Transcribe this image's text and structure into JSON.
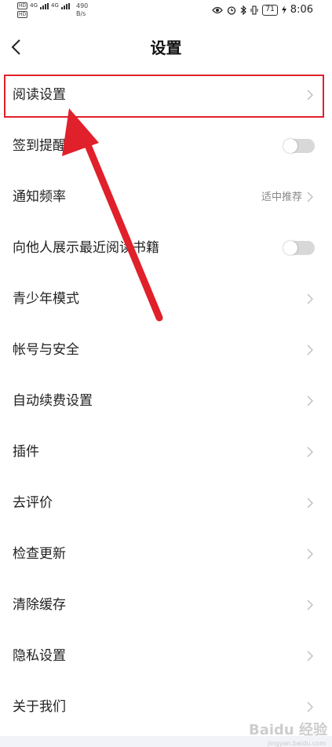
{
  "status_bar": {
    "net1": "4G",
    "net2": "4G",
    "speed_value": "490",
    "speed_unit": "B/s",
    "battery": "71",
    "time": "8:06"
  },
  "header": {
    "title": "设置"
  },
  "settings": [
    {
      "label": "阅读设置",
      "control": "chevron"
    },
    {
      "label": "签到提醒",
      "control": "toggle",
      "on": false
    },
    {
      "label": "通知频率",
      "control": "chevron",
      "value": "适中推荐"
    },
    {
      "label": "向他人展示最近阅读书籍",
      "control": "toggle",
      "on": false
    },
    {
      "label": "青少年模式",
      "control": "chevron"
    },
    {
      "label": "帐号与安全",
      "control": "chevron"
    },
    {
      "label": "自动续费设置",
      "control": "chevron"
    },
    {
      "label": "插件",
      "control": "chevron"
    },
    {
      "label": "去评价",
      "control": "chevron"
    },
    {
      "label": "检查更新",
      "control": "chevron"
    },
    {
      "label": "清除缓存",
      "control": "chevron"
    },
    {
      "label": "隐私设置",
      "control": "chevron"
    },
    {
      "label": "关于我们",
      "control": "chevron"
    }
  ],
  "watermark": {
    "brand": "Baidu 经验",
    "url": "jingyan.baidu.com"
  },
  "colors": {
    "annotation": "#e0202a",
    "toggle_off": "#d8d8d8"
  }
}
